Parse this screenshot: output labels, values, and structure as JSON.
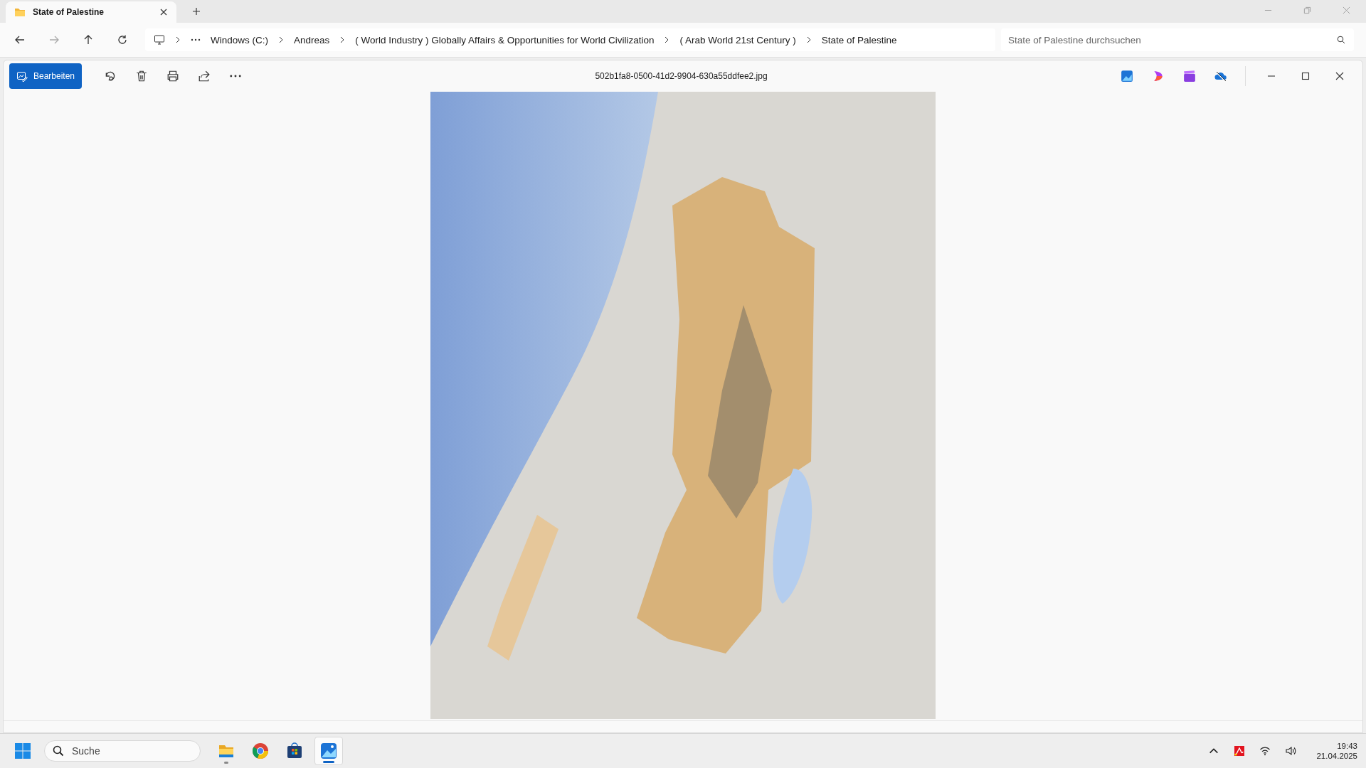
{
  "tab": {
    "title": "State of Palestine",
    "selected": true
  },
  "breadcrumbs": [
    "Windows (C:)",
    "Andreas",
    "( World Industry ) Globally Affairs & Opportunities for World Civilization",
    "( Arab World 21st Century )",
    "State of Palestine"
  ],
  "search": {
    "placeholder": "State of Palestine durchsuchen"
  },
  "viewer": {
    "edit_button": "Bearbeiten",
    "filename": "502b1fa8-0500-41d2-9904-630a55ddfee2.jpg"
  },
  "taskbar": {
    "search_placeholder": "Suche",
    "apps": [
      {
        "kind": "explorer",
        "running": true,
        "selected": false
      },
      {
        "kind": "chrome",
        "running": false,
        "selected": false
      },
      {
        "kind": "store",
        "running": false,
        "selected": false
      },
      {
        "kind": "photos",
        "running": true,
        "selected": true
      }
    ],
    "time": "19:43",
    "date": "21.04.2025"
  }
}
